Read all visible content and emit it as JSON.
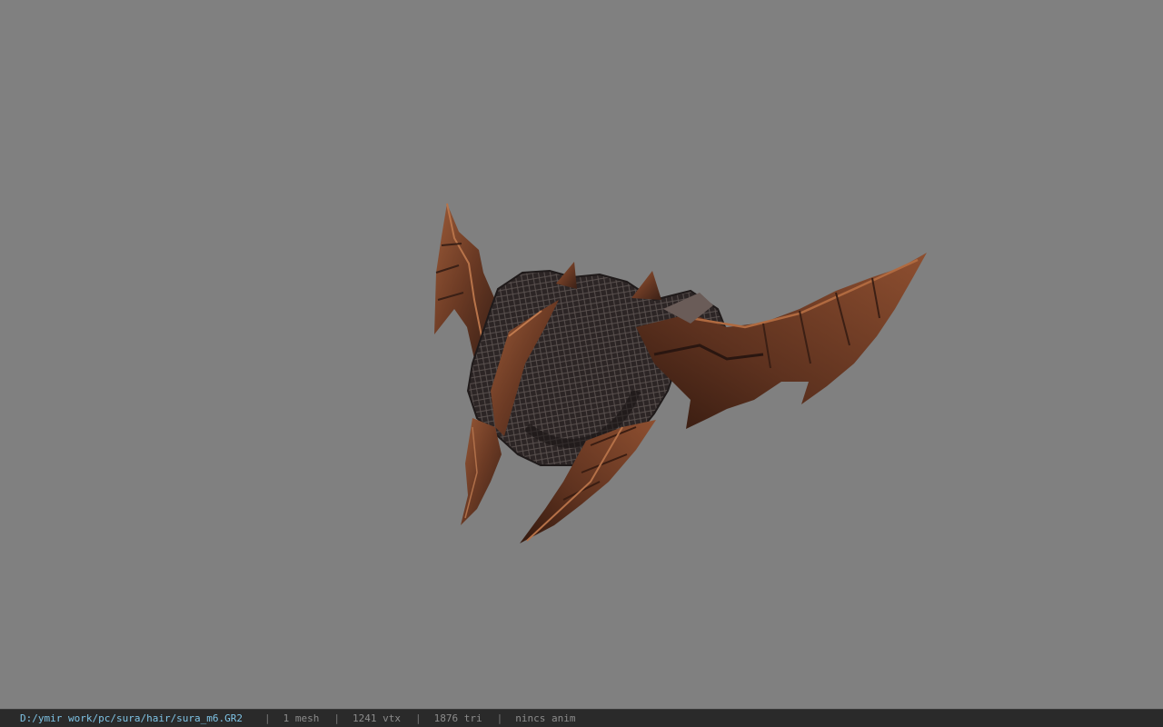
{
  "status": {
    "path": "D:/ymir work/pc/sura/hair/sura_m6.GR2",
    "separator": "|",
    "mesh": "1 mesh",
    "vtx": "1241 vtx",
    "tri": "1876 tri",
    "anim": "nincs anim"
  },
  "colors": {
    "background": "#808080",
    "statusbar": "#2a2a2a",
    "path_text": "#7fc4e6",
    "info_text": "#8c8c8c"
  }
}
